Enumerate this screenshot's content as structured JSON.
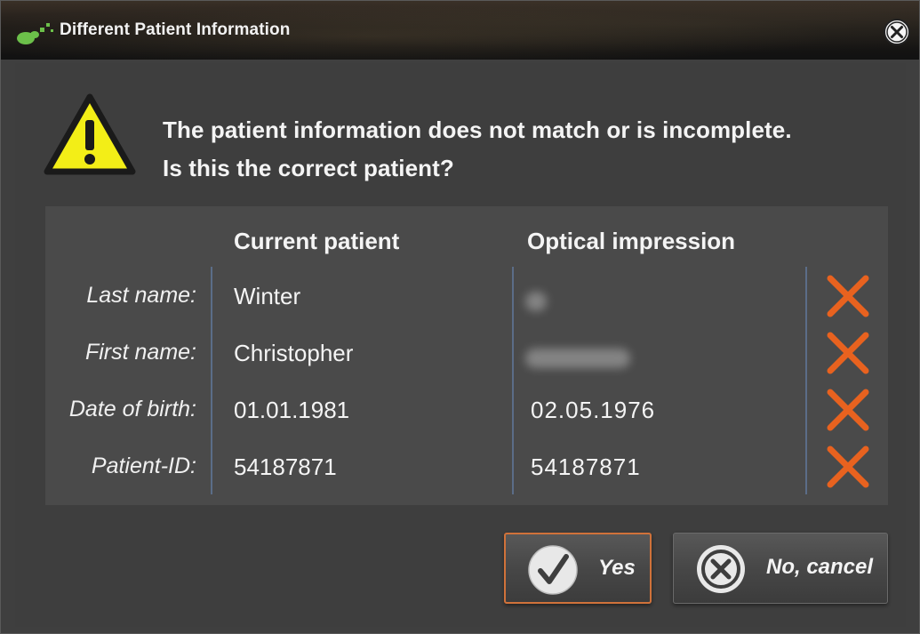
{
  "window": {
    "title": "Different Patient Information"
  },
  "message": {
    "line1": "The patient information does not match or is incomplete.",
    "line2": "Is this the correct patient?"
  },
  "table": {
    "headers": {
      "current": "Current patient",
      "optical": "Optical impression"
    },
    "rows": [
      {
        "label": "Last name:",
        "current": "Winter",
        "optical": "",
        "optical_blurred": true,
        "match": false
      },
      {
        "label": "First name:",
        "current": "Christopher",
        "optical": "",
        "optical_blurred": true,
        "match": false
      },
      {
        "label": "Date of birth:",
        "current": "01.01.1981",
        "optical": "02.05.1976",
        "optical_blurred": false,
        "match": false
      },
      {
        "label": "Patient-ID:",
        "current": "54187871",
        "optical": "54187871",
        "optical_blurred": false,
        "match": false
      }
    ]
  },
  "buttons": {
    "yes_label": "Yes",
    "no_label": "No, cancel"
  },
  "colors": {
    "accent": "#d0723a",
    "mismatch": "#e8621f",
    "warning_yellow": "#f3ee17",
    "logo_green": "#6cc04a",
    "divider": "#5b6d88"
  },
  "icons": {
    "title": "app-logo-icon",
    "close": "close-circle-icon",
    "warning": "warning-triangle-icon",
    "mismatch": "red-x-icon",
    "yes": "checkmark-circle-icon",
    "no": "x-circle-icon"
  }
}
